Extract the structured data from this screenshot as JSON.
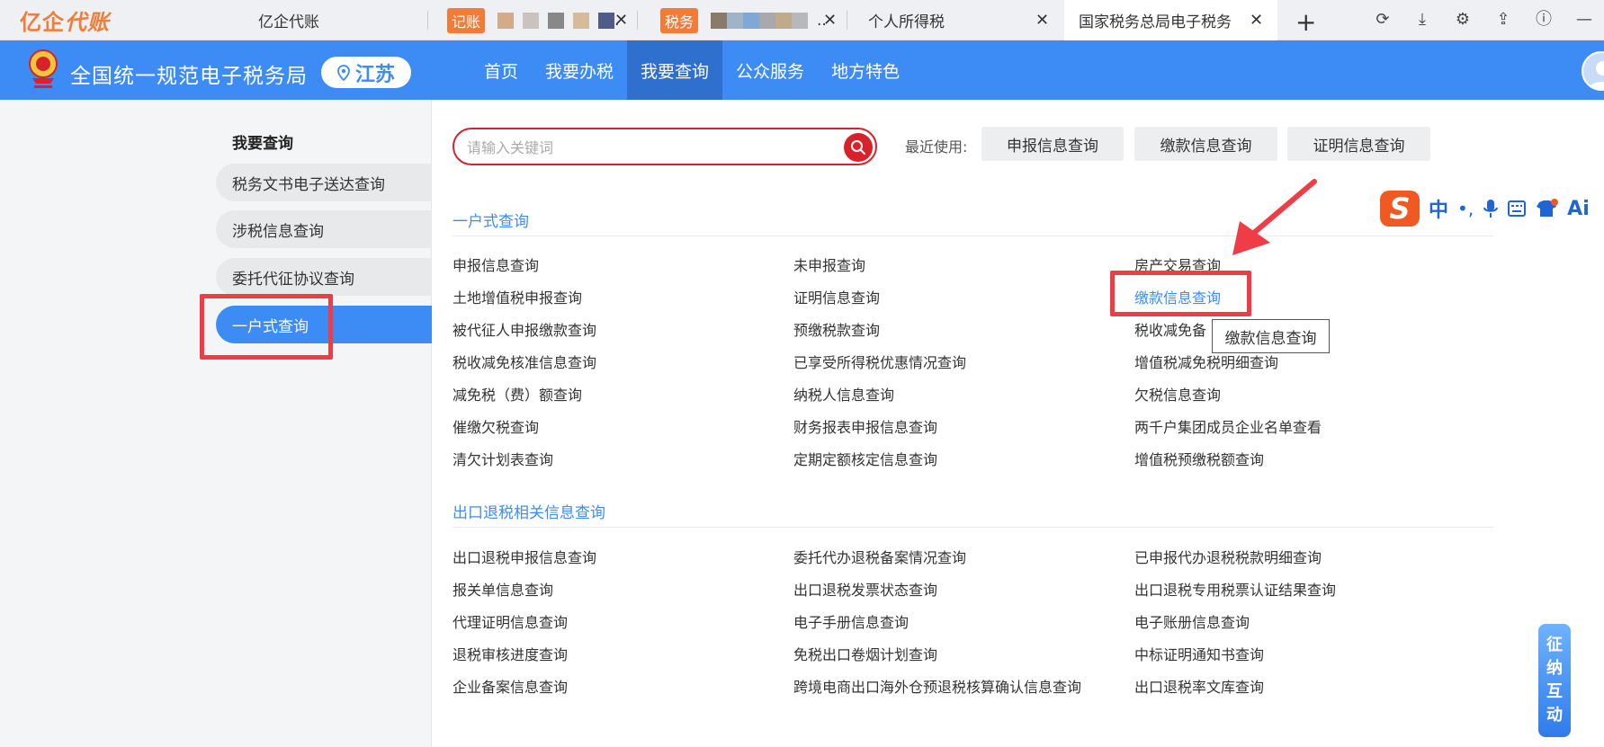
{
  "browser": {
    "logo_part1": "亿企",
    "logo_part2": "代账",
    "tabs": [
      {
        "label": "亿企代账"
      },
      {
        "badge": "记账",
        "label": "."
      },
      {
        "badge": "税务",
        "label": ".."
      },
      {
        "label": "个人所得税"
      },
      {
        "label": "国家税务总局电子税务",
        "active": true
      }
    ],
    "new_tab": "+",
    "tab_close": "✕"
  },
  "header": {
    "site_title": "全国统一规范电子税务局",
    "region": "江苏",
    "nav": [
      "首页",
      "我要办税",
      "我要查询",
      "公众服务",
      "地方特色"
    ],
    "nav_active": "我要查询",
    "brand_color": "#3d8cf5"
  },
  "sidebar": {
    "heading": "我要查询",
    "items": [
      {
        "label": "税务文书电子送达查询"
      },
      {
        "label": "涉税信息查询"
      },
      {
        "label": "委托代征协议查询"
      },
      {
        "label": "一户式查询",
        "active": true
      }
    ]
  },
  "search": {
    "placeholder": "请输入关键词",
    "value": "",
    "recent_label": "最近使用:",
    "recent": [
      "申报信息查询",
      "缴款信息查询",
      "证明信息查询"
    ]
  },
  "sections": [
    {
      "title": "一户式查询",
      "columns": [
        [
          "申报信息查询",
          "土地增值税申报查询",
          "被代征人申报缴款查询",
          "税收减免核准信息查询",
          "减免税（费）额查询",
          "催缴欠税查询",
          "清欠计划表查询"
        ],
        [
          "未申报查询",
          "证明信息查询",
          "预缴税款查询",
          "已享受所得税优惠情况查询",
          "纳税人信息查询",
          "财务报表申报信息查询",
          "定期定额核定信息查询"
        ],
        [
          "房产交易查询",
          "缴款信息查询",
          "税收减免备",
          "增值税减免税明细查询",
          "欠税信息查询",
          "两千户集团成员企业名单查看",
          "增值税预缴税额查询"
        ]
      ]
    },
    {
      "title": "出口退税相关信息查询",
      "columns": [
        [
          "出口退税申报信息查询",
          "报关单信息查询",
          "代理证明信息查询",
          "退税审核进度查询",
          "企业备案信息查询"
        ],
        [
          "委托代办退税备案情况查询",
          "出口退税发票状态查询",
          "电子手册信息查询",
          "免税出口卷烟计划查询",
          "跨境电商出口海外仓预退税核算确认信息查询"
        ],
        [
          "已申报代办退税税款明细查询",
          "出口退税专用税票认证结果查询",
          "电子账册信息查询",
          "中标证明通知书查询",
          "出口退税率文库查询"
        ]
      ]
    }
  ],
  "highlighted_link": "缴款信息查询",
  "tooltip": "缴款信息查询",
  "ime": {
    "mode": "中",
    "logo": "S",
    "ai": "Ai"
  },
  "float_widget": [
    "征",
    "纳",
    "互",
    "动"
  ],
  "colors": {
    "accent": "#3d8cf5",
    "search_red": "#d8222b",
    "annotation_red": "#ef3c46",
    "brand_orange": "#f07c3a"
  }
}
